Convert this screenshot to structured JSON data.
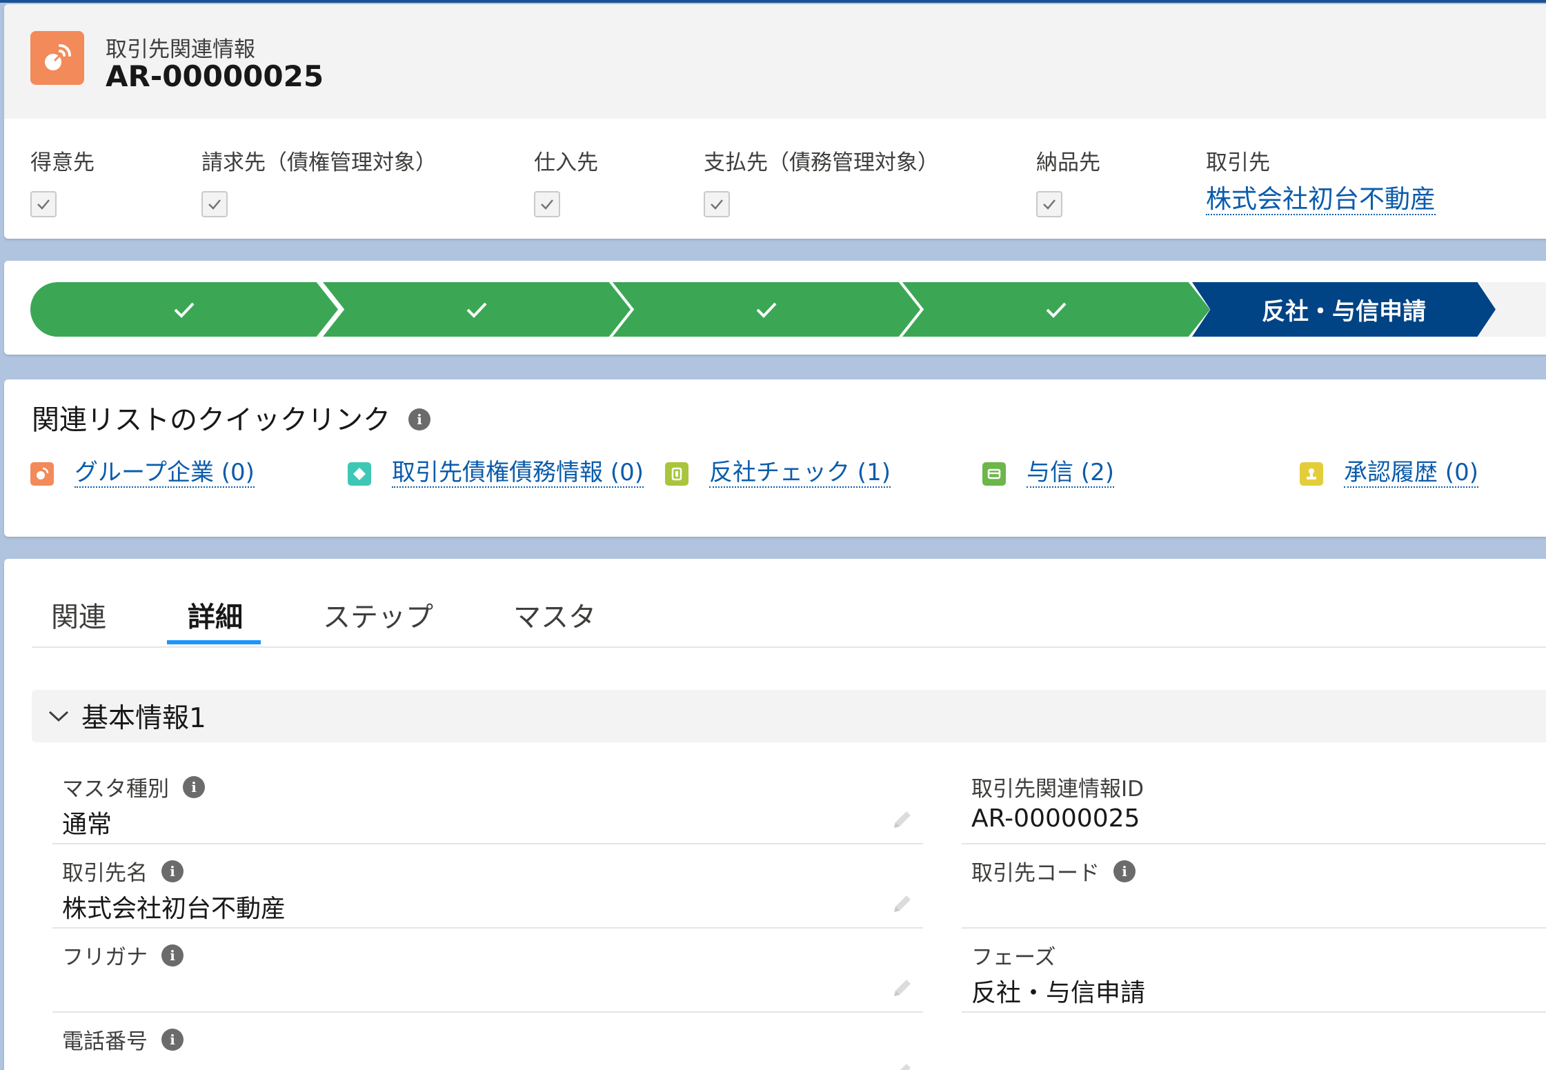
{
  "header": {
    "record_type": "取引先関連情報",
    "record_name": "AR-00000025",
    "icon": "satellite-dish-icon",
    "highlights": [
      {
        "label": "得意先",
        "checked": true
      },
      {
        "label": "請求先（債権管理対象）",
        "checked": true
      },
      {
        "label": "仕入先",
        "checked": true
      },
      {
        "label": "支払先（債務管理対象）",
        "checked": true
      },
      {
        "label": "納品先",
        "checked": true
      }
    ],
    "account": {
      "label": "取引先",
      "value": "株式会社初台不動産"
    }
  },
  "path": {
    "steps": [
      {
        "status": "complete"
      },
      {
        "status": "complete"
      },
      {
        "status": "complete"
      },
      {
        "status": "complete"
      },
      {
        "status": "current",
        "label": "反社・与信申請"
      },
      {
        "status": "incomplete"
      }
    ],
    "colors": {
      "complete": "#3ba755",
      "current": "#014486",
      "incomplete": "#f3f3f3"
    }
  },
  "quick_links": {
    "title": "関連リストのクイックリンク",
    "items": [
      {
        "label": "グループ企業 (0)",
        "icon": "satellite-icon",
        "color": "#f38a5a"
      },
      {
        "label": "取引先債権債務情報 (0)",
        "icon": "diamond-icon",
        "color": "#3fc7b6"
      },
      {
        "label": "反社チェック (1)",
        "icon": "document-icon",
        "color": "#a8c53c"
      },
      {
        "label": "与信 (2)",
        "icon": "card-icon",
        "color": "#6cb64a"
      },
      {
        "label": "承認履歴 (0)",
        "icon": "stamp-icon",
        "color": "#e3cd3a"
      }
    ]
  },
  "tabs": [
    {
      "label": "関連",
      "active": false
    },
    {
      "label": "詳細",
      "active": true
    },
    {
      "label": "ステップ",
      "active": false
    },
    {
      "label": "マスタ",
      "active": false
    }
  ],
  "section": {
    "title": "基本情報1",
    "left_fields": [
      {
        "label": "マスタ種別",
        "value": "通常",
        "info": true,
        "editable": true
      },
      {
        "label": "取引先名",
        "value": "株式会社初台不動産",
        "info": true,
        "editable": true
      },
      {
        "label": "フリガナ",
        "value": "",
        "info": true,
        "editable": true
      },
      {
        "label": "電話番号",
        "value": "",
        "info": true,
        "editable": true
      }
    ],
    "right_fields": [
      {
        "label": "取引先関連情報ID",
        "value": "AR-00000025",
        "info": false
      },
      {
        "label": "取引先コード",
        "value": "",
        "info": true
      },
      {
        "label": "フェーズ",
        "value": "反社・与信申請",
        "info": false
      }
    ]
  }
}
